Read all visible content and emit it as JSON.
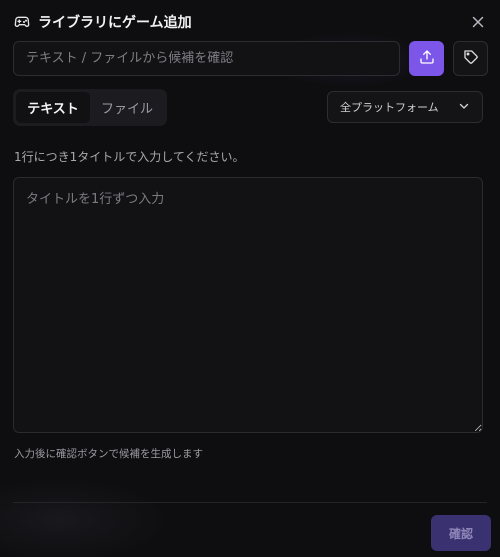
{
  "dialog": {
    "title": "ライブラリにゲーム追加"
  },
  "search": {
    "placeholder": "テキスト / ファイルから候補を確認"
  },
  "tabs": [
    {
      "label": "テキスト",
      "active": true
    },
    {
      "label": "ファイル",
      "active": false
    }
  ],
  "platform": {
    "selected": "全プラットフォーム"
  },
  "input": {
    "hint": "1行につき1タイトルで入力してください。",
    "placeholder": "タイトルを1行ずつ入力",
    "sub_hint": "入力後に確認ボタンで候補を生成します"
  },
  "footer": {
    "confirm_label": "確認"
  },
  "colors": {
    "accent": "#7b56e8",
    "confirm_disabled": "#3a3170",
    "background": "#0e0e10"
  },
  "icons": {
    "title": "gamepad-icon",
    "close": "close-icon",
    "upload": "upload-icon",
    "tag": "tag-icon",
    "dropdown": "chevron-down-icon"
  }
}
